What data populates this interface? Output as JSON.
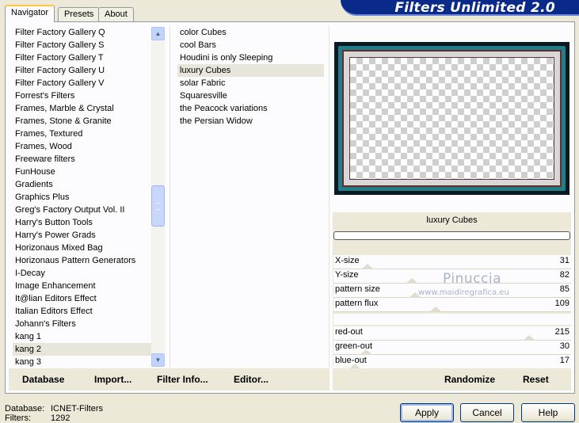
{
  "tabs": [
    {
      "label": "Navigator",
      "active": true
    },
    {
      "label": "Presets",
      "active": false
    },
    {
      "label": "About",
      "active": false
    }
  ],
  "banner": {
    "title": "Filters Unlimited 2.0"
  },
  "categories": {
    "items": [
      "Filter Factory Gallery Q",
      "Filter Factory Gallery S",
      "Filter Factory Gallery T",
      "Filter Factory Gallery U",
      "Filter Factory Gallery V",
      "Forrest's Filters",
      "Frames, Marble & Crystal",
      "Frames, Stone & Granite",
      "Frames, Textured",
      "Frames, Wood",
      "Freeware filters",
      "FunHouse",
      "Gradients",
      "Graphics Plus",
      "Greg's Factory Output Vol. II",
      "Harry's Button Tools",
      "Harry's Power Grads",
      "Horizonaus Mixed Bag",
      "Horizonaus Pattern Generators",
      "I-Decay",
      "Image Enhancement",
      "It@lian Editors Effect",
      "Italian Editors Effect",
      "Johann's Filters",
      "kang 1",
      "kang 2",
      "kang 3"
    ],
    "selected": "kang 2"
  },
  "filters": {
    "items": [
      "color Cubes",
      "cool Bars",
      "Houdini is only Sleeping",
      "luxury Cubes",
      "solar Fabric",
      "Squaresville",
      "the Peacock variations",
      "the Persian Widow"
    ],
    "selected": "luxury Cubes"
  },
  "preview": {
    "filter_name": "luxury Cubes",
    "progress": 0
  },
  "params": {
    "group1": [
      {
        "label": "X-size",
        "value": 31
      },
      {
        "label": "Y-size",
        "value": 82
      },
      {
        "label": "pattern size",
        "value": 85
      },
      {
        "label": "pattern flux",
        "value": 109
      }
    ],
    "group2": [
      {
        "label": "red-out",
        "value": 215
      },
      {
        "label": "green-out",
        "value": 30
      },
      {
        "label": "blue-out",
        "value": 17
      }
    ],
    "max": 255
  },
  "watermark": {
    "line1": "Pinuccia",
    "line2": "www.maidiregrafica.eu"
  },
  "left_buttons": {
    "database": "Database",
    "import": "Import...",
    "filter_info": "Filter Info...",
    "editor": "Editor..."
  },
  "right_buttons": {
    "randomize": "Randomize",
    "reset": "Reset"
  },
  "status": {
    "database_label": "Database:",
    "database_value": "ICNET-Filters",
    "filters_label": "Filters:",
    "filters_value": "1292"
  },
  "dialog_buttons": {
    "apply": "Apply",
    "cancel": "Cancel",
    "help": "Help"
  },
  "colors": {
    "banner": "#0a2a8a",
    "preview_accent": "#1f7f88",
    "frame_border": "#6a2a2a"
  }
}
